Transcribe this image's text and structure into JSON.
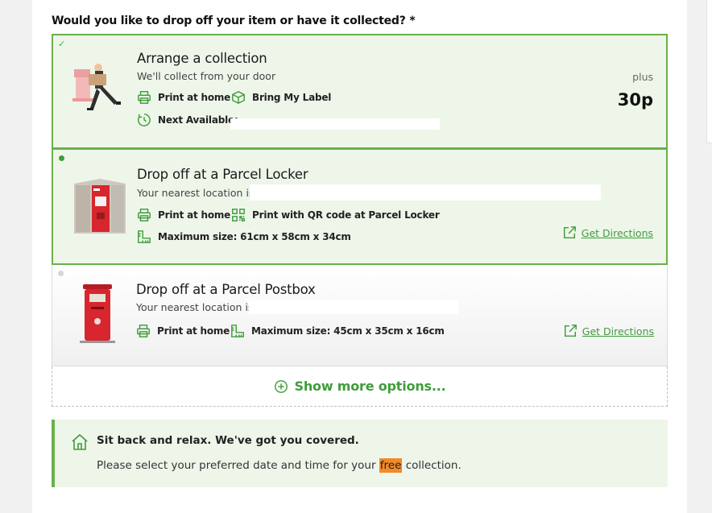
{
  "question": "Would you like to drop off your item or have it collected? *",
  "colors": {
    "accent": "#6ab04c",
    "link": "#3e9d3a",
    "selected_bg": "#eef6ea",
    "highlight": "#f28a2b",
    "postbox_red": "#d7262e"
  },
  "options": {
    "collection": {
      "title": "Arrange a collection",
      "subtitle": "We'll collect from your door",
      "feature_print": "Print at home",
      "feature_label": "Bring My Label",
      "next_available_label": "Next Available:",
      "price_prefix": "plus",
      "price": "30p"
    },
    "locker": {
      "title": "Drop off at a Parcel Locker",
      "subtitle": "Your nearest location is",
      "feature_print": "Print at home",
      "feature_qr": "Print with QR code at Parcel Locker",
      "max_size": "Maximum size: 61cm x 58cm x 34cm",
      "directions": "Get Directions"
    },
    "postbox": {
      "title": "Drop off at a Parcel Postbox",
      "subtitle": "Your nearest location is",
      "feature_print": "Print at home",
      "max_size": "Maximum size: 45cm x 35cm x 16cm",
      "directions": "Get Directions"
    }
  },
  "show_more": "Show more options...",
  "notice": {
    "title": "Sit back and relax. We've got you covered.",
    "text_before": "Please select your preferred date and time for your ",
    "highlight": "free",
    "text_after": " collection."
  }
}
